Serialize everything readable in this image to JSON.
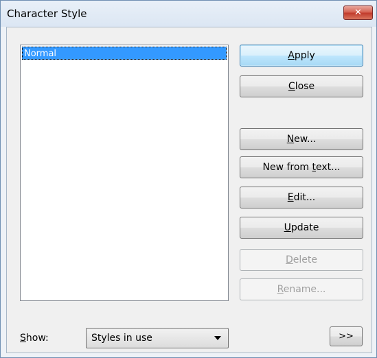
{
  "window": {
    "title": "Character Style"
  },
  "title_controls": {
    "close_glyph": "✕"
  },
  "styles_list": {
    "items": [
      "Normal"
    ],
    "selected_index": 0
  },
  "buttons": {
    "apply": {
      "access": "A",
      "rest": "pply"
    },
    "close": {
      "access": "C",
      "rest": "lose"
    },
    "new": {
      "access": "N",
      "rest": "ew..."
    },
    "new_from_text": {
      "pre": "New from ",
      "access": "t",
      "rest": "ext..."
    },
    "edit": {
      "access": "E",
      "rest": "dit..."
    },
    "update": {
      "access": "U",
      "rest": "pdate"
    },
    "delete": {
      "access": "D",
      "rest": "elete"
    },
    "rename": {
      "access": "R",
      "rest": "ename..."
    },
    "more": ">>"
  },
  "show": {
    "label_access": "S",
    "label_rest": "how:",
    "selected": "Styles in use"
  }
}
